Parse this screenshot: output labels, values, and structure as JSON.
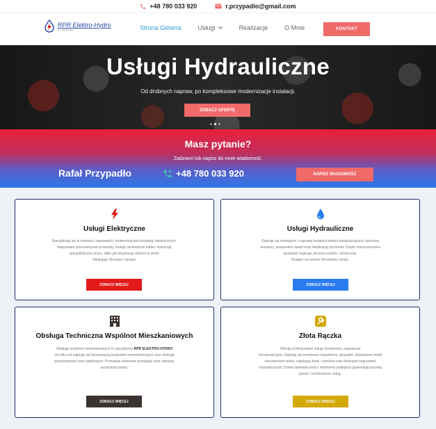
{
  "topbar": {
    "phone": "+48 780 033 920",
    "email": "r.przypadlo@gmail.com"
  },
  "logo": {
    "name": "RPR Elektro-Hydro",
    "sub": "Tel: 780 033 920"
  },
  "nav": {
    "items": [
      "Strona Główna",
      "Usługi",
      "Realizacje",
      "O Mnie"
    ],
    "cta": "KONTAKT"
  },
  "hero": {
    "title": "Usługi Hydrauliczne",
    "subtitle": "Od drobnych napraw, po kompleksowe modernizacje instalacji.",
    "button": "ZOBACZ OFERTĘ"
  },
  "cta": {
    "title": "Masz pytanie?",
    "subtitle": "Zadzwoń lub napisz do mnie wiadomość.",
    "name": "Rafał Przypadło",
    "phone": "+48 780 033 920",
    "button": "NAPISZ WIADOMOŚĆ"
  },
  "cards": [
    {
      "title": "Usługi Elektryczne",
      "icon": "bolt-icon",
      "lines": [
        "Specjalizuję się w montażu, naprawach i modernizacjach instalacji elektrycznych.",
        "Naprawiam przerwiercone przewody, mufuję uszkodzone kable i wykonuję",
        "specjalistyczne prace, takie jak lokalizacja usterek w ziemi.",
        "Obsługuję Wrocław i okolice."
      ],
      "button": "ZOBACZ WIĘCEJ",
      "color": "#e21a1a"
    },
    {
      "title": "Usługi Hydrauliczne",
      "icon": "water-drop-icon",
      "lines": [
        "Zajmuję się montażem i naprawą instalacji wodno-kanalizacyjnych, wymianą",
        "armatury, usuwaniem awarii oraz lokalizacją wycieków. Dzięki nowoczesnemu",
        "sprzętowi realizuję zlecenia szybko i skutecznie.",
        "Działam na terenie Wrocławia i okolic."
      ],
      "button": "ZOBACZ WIĘCEJ",
      "color": "#2b7bf0"
    },
    {
      "title": "Obsługa Techniczna Wspólnot Mieszkaniowych",
      "icon": "building-icon",
      "lines_bold_prefix": "Obsługa wspólnot mieszkaniowych to specjalność ",
      "lines_bold": "RPR ELEKTRO-HYDRO",
      "lines": [
        "Od kilku lat zajmuję się konserwacją budynków mieszkaniowych oraz obsługą",
        "przepompowni wód opadowych. Prowadzę okresowe przeglądy oraz naprawy",
        "automatyki pomp."
      ],
      "button": "ZOBACZ WIĘCEJ",
      "color": "#3b3330"
    },
    {
      "title": "Złota Rączka",
      "icon": "handyman-icon",
      "lines": [
        "Oferuję profesjonalne usługi montażowe, naprawcze",
        "i konserwacyjne. Zajmuję się montażem oświetlenia, gniazdek, składaniem mebli,",
        "mocowaniem półek, regulacją drzwi i zamków oraz drobnymi naprawami",
        "hydraulicznymi. Dzięki doświadczeniu i solidnemu podejściu gwarantuję wysoką",
        "jakość i terminowość usług."
      ],
      "button": "ZOBACZ WIĘCEJ",
      "color": "#d4a80a"
    }
  ]
}
